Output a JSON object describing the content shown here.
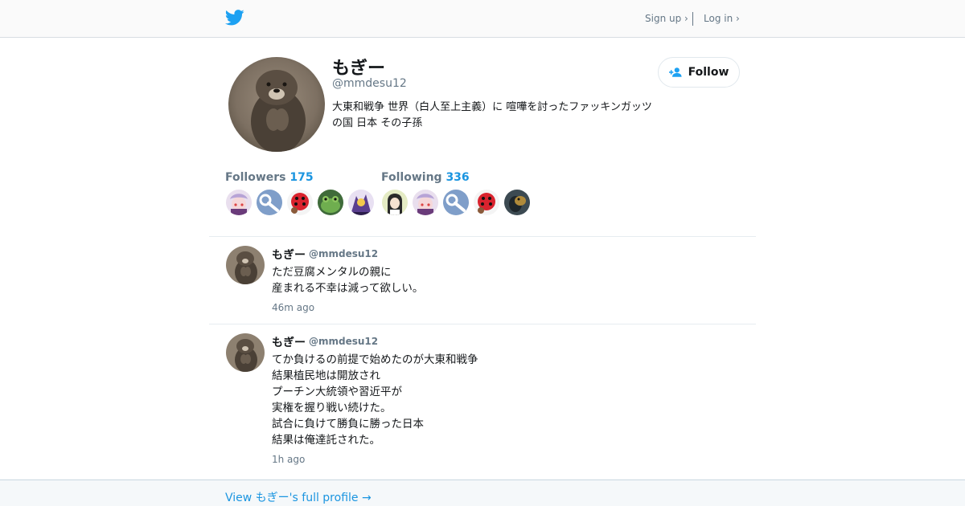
{
  "header": {
    "signup_label": "Sign up ›",
    "login_label": "Log in ›",
    "logo_icon": "twitter-bird-icon",
    "brand_color": "#1da1f2"
  },
  "profile": {
    "name": "もぎー",
    "handle": "@mmdesu12",
    "bio": "大東和戦争 世界（白人至上主義）に 喧嘩を討ったファッキンガッツの国 日本 その子孫",
    "follow_label": "Follow",
    "followers_label": "Followers",
    "followers_count": "175",
    "following_label": "Following",
    "following_count": "336"
  },
  "tweets": [
    {
      "name": "もぎー",
      "handle": "@mmdesu12",
      "text": "ただ豆腐メンタルの親に\n産まれる不幸は減って欲しい。",
      "time": "46m ago"
    },
    {
      "name": "もぎー",
      "handle": "@mmdesu12",
      "text": "てか負けるの前提で始めたのが大東和戦争\n結果植民地は開放され\nプーチン大統領や習近平が\n実権を握り戦い続けた。\n試合に負けて勝負に勝った日本\n結果は俺達託された。",
      "time": "1h ago"
    }
  ],
  "footer": {
    "link_label": "View もぎー's full profile →"
  },
  "colors": {
    "accent": "#1b95e0",
    "muted": "#657786",
    "text": "#14171a"
  }
}
